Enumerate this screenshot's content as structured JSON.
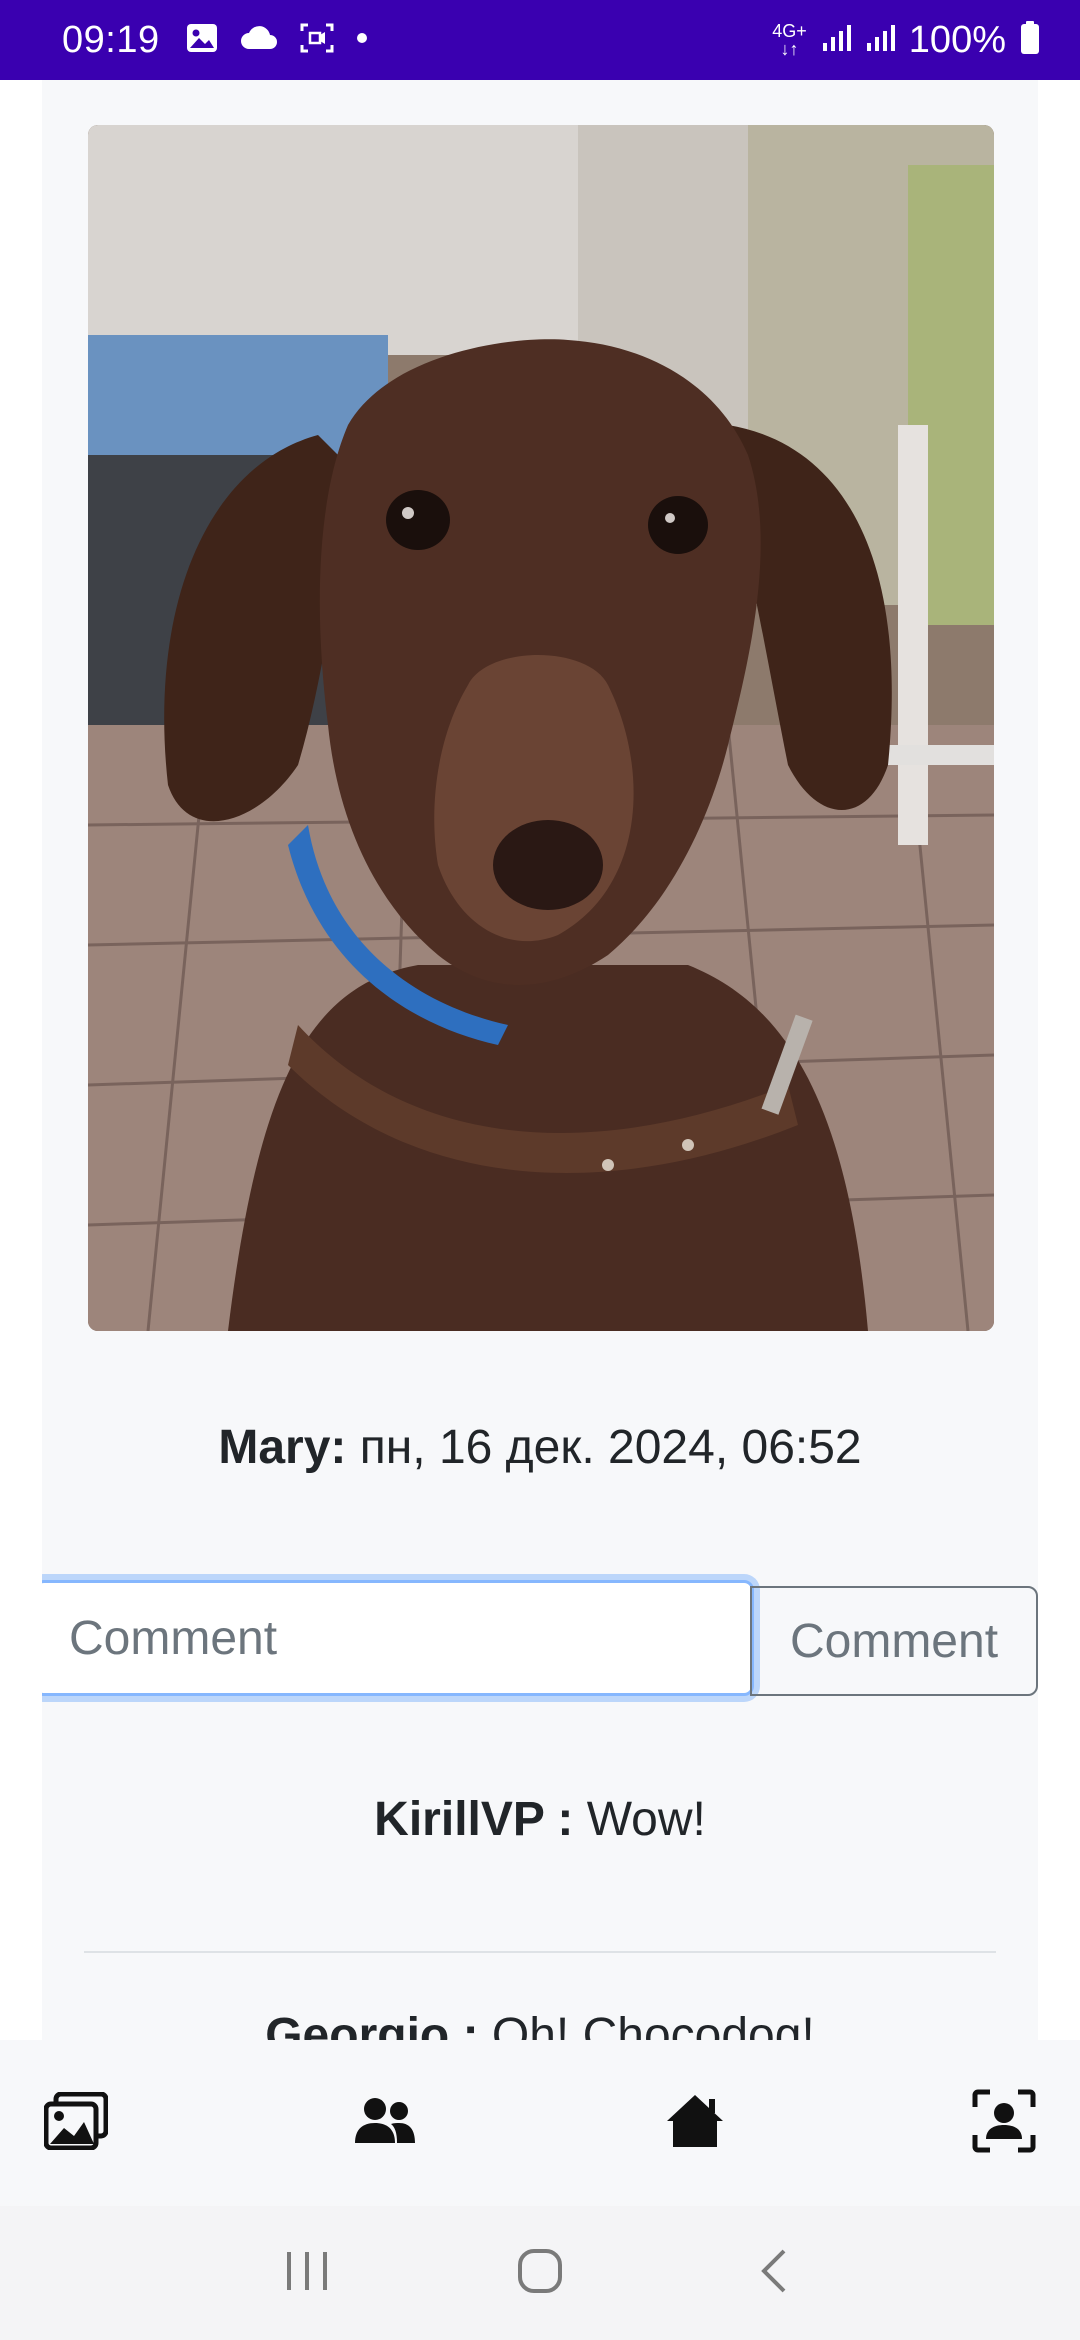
{
  "status_bar": {
    "time": "09:19",
    "battery": "100%",
    "network_top": "4G+",
    "background": "#3a00b0",
    "left_icons": [
      "image-icon",
      "cloud-icon",
      "screen-record-icon",
      "dot-icon"
    ],
    "right_icons": [
      "network-arrows-icon",
      "signal-icon",
      "signal-icon",
      "battery-icon"
    ]
  },
  "post": {
    "author": "Mary:",
    "date": "пн, 16 дек. 2024, 06:52"
  },
  "comment_form": {
    "placeholder": "Comment",
    "value": "",
    "button_label": "Comment"
  },
  "comments": [
    {
      "author": "KirillVP :",
      "text": "Wow!"
    },
    {
      "author": "Georgio :",
      "text": "Oh! Chocodog!"
    }
  ],
  "bottom_nav": {
    "items": [
      "gallery-icon",
      "users-icon",
      "home-icon",
      "profile-icon"
    ]
  },
  "system_nav": {
    "items": [
      "recents-icon",
      "home-circle-icon",
      "back-icon"
    ]
  }
}
